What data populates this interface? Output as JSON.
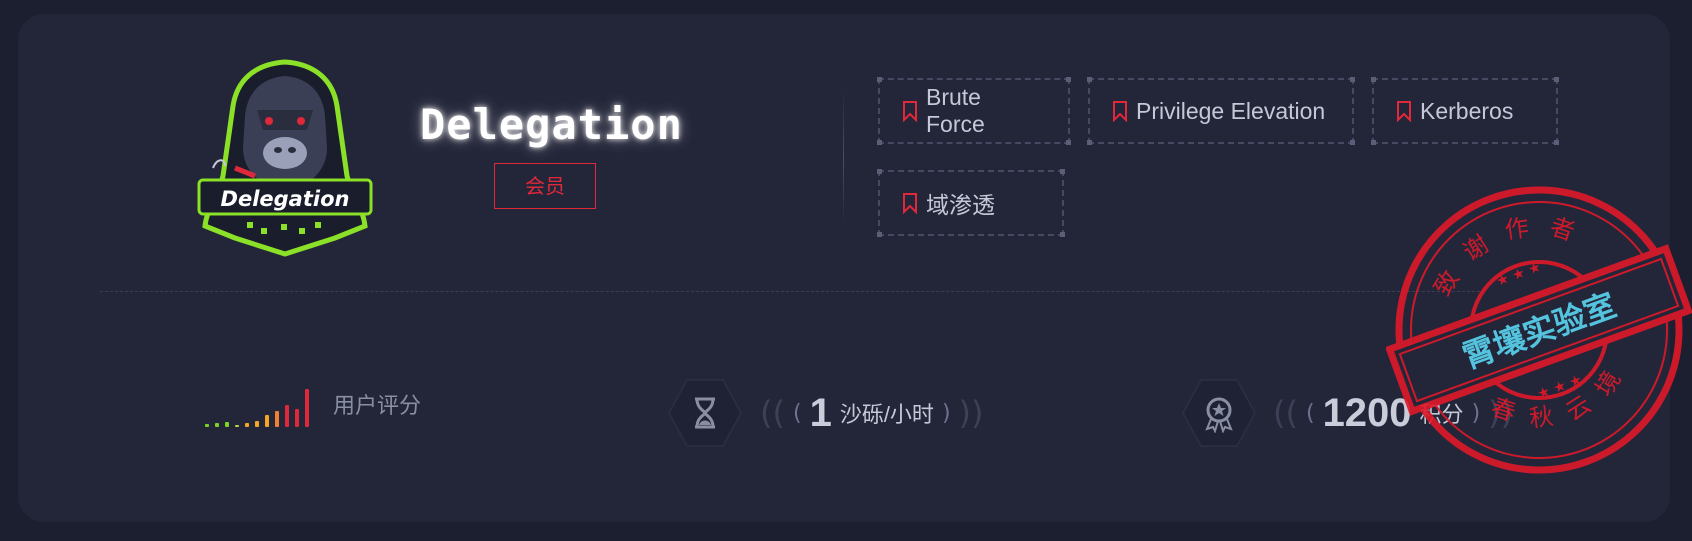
{
  "machine": {
    "logo_text": "Delegation",
    "title": "Delegation",
    "badge": "会员"
  },
  "tags": [
    {
      "label": "Brute Force"
    },
    {
      "label": "Privilege Elevation"
    },
    {
      "label": "Kerberos"
    },
    {
      "label": "域渗透"
    }
  ],
  "rating": {
    "label": "用户评分",
    "bar_colors": [
      "#7ed321",
      "#7ed321",
      "#7ed321",
      "#b8d84a",
      "#f5a623",
      "#f5a623",
      "#f5a623",
      "#f08030",
      "#e0283b",
      "#e0283b",
      "#e0283b"
    ]
  },
  "stats": {
    "sand": {
      "value": "1",
      "unit": "沙砾/小时",
      "icon": "hourglass-icon"
    },
    "points": {
      "value": "1200",
      "unit": "积分",
      "icon": "medal-icon"
    }
  },
  "stamp": {
    "top_text": "致谢作者",
    "banner_text": "霄壤实验室",
    "bottom_text": "春秋云境",
    "color": "#e0192a",
    "banner_text_color": "#5ad4f0"
  }
}
